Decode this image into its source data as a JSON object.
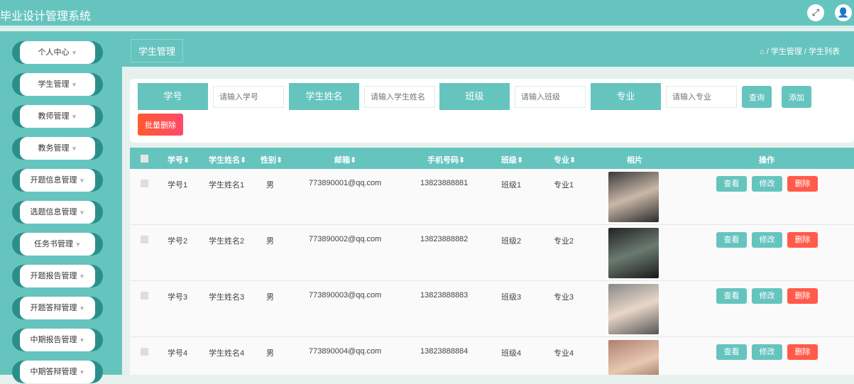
{
  "app_title": "毕业设计管理系统",
  "sidebar": {
    "items": [
      {
        "label": "个人中心"
      },
      {
        "label": "学生管理"
      },
      {
        "label": "教师管理"
      },
      {
        "label": "教务管理"
      },
      {
        "label": "开题信息管理"
      },
      {
        "label": "选题信息管理"
      },
      {
        "label": "任务书管理"
      },
      {
        "label": "开题报告管理"
      },
      {
        "label": "开题答辩管理"
      },
      {
        "label": "中期报告管理"
      },
      {
        "label": "中期答辩管理"
      }
    ]
  },
  "page_title": "学生管理",
  "breadcrumb": {
    "sep": "/",
    "items": [
      "学生管理",
      "学生列表"
    ]
  },
  "search": {
    "fields": [
      {
        "label": "学号",
        "placeholder": "请输入学号"
      },
      {
        "label": "学生姓名",
        "placeholder": "请输入学生姓名"
      },
      {
        "label": "班级",
        "placeholder": "请输入班级"
      },
      {
        "label": "专业",
        "placeholder": "请输入专业"
      }
    ],
    "query": "查询",
    "add": "添加",
    "batch_delete": "批量删除"
  },
  "table": {
    "headers": [
      "学号",
      "学生姓名",
      "性别",
      "邮箱",
      "手机号码",
      "班级",
      "专业",
      "相片",
      "操作"
    ],
    "actions": {
      "view": "查看",
      "edit": "修改",
      "delete": "删除"
    },
    "rows": [
      {
        "id": "学号1",
        "name": "学生姓名1",
        "gender": "男",
        "email": "773890001@qq.com",
        "phone": "13823888881",
        "class": "班级1",
        "major": "专业1"
      },
      {
        "id": "学号2",
        "name": "学生姓名2",
        "gender": "男",
        "email": "773890002@qq.com",
        "phone": "13823888882",
        "class": "班级2",
        "major": "专业2"
      },
      {
        "id": "学号3",
        "name": "学生姓名3",
        "gender": "男",
        "email": "773890003@qq.com",
        "phone": "13823888883",
        "class": "班级3",
        "major": "专业3"
      },
      {
        "id": "学号4",
        "name": "学生姓名4",
        "gender": "男",
        "email": "773890004@qq.com",
        "phone": "13823888884",
        "class": "班级4",
        "major": "专业4"
      }
    ]
  },
  "colors": {
    "accent": "#66c4bf",
    "danger": "#ff5a4a"
  }
}
